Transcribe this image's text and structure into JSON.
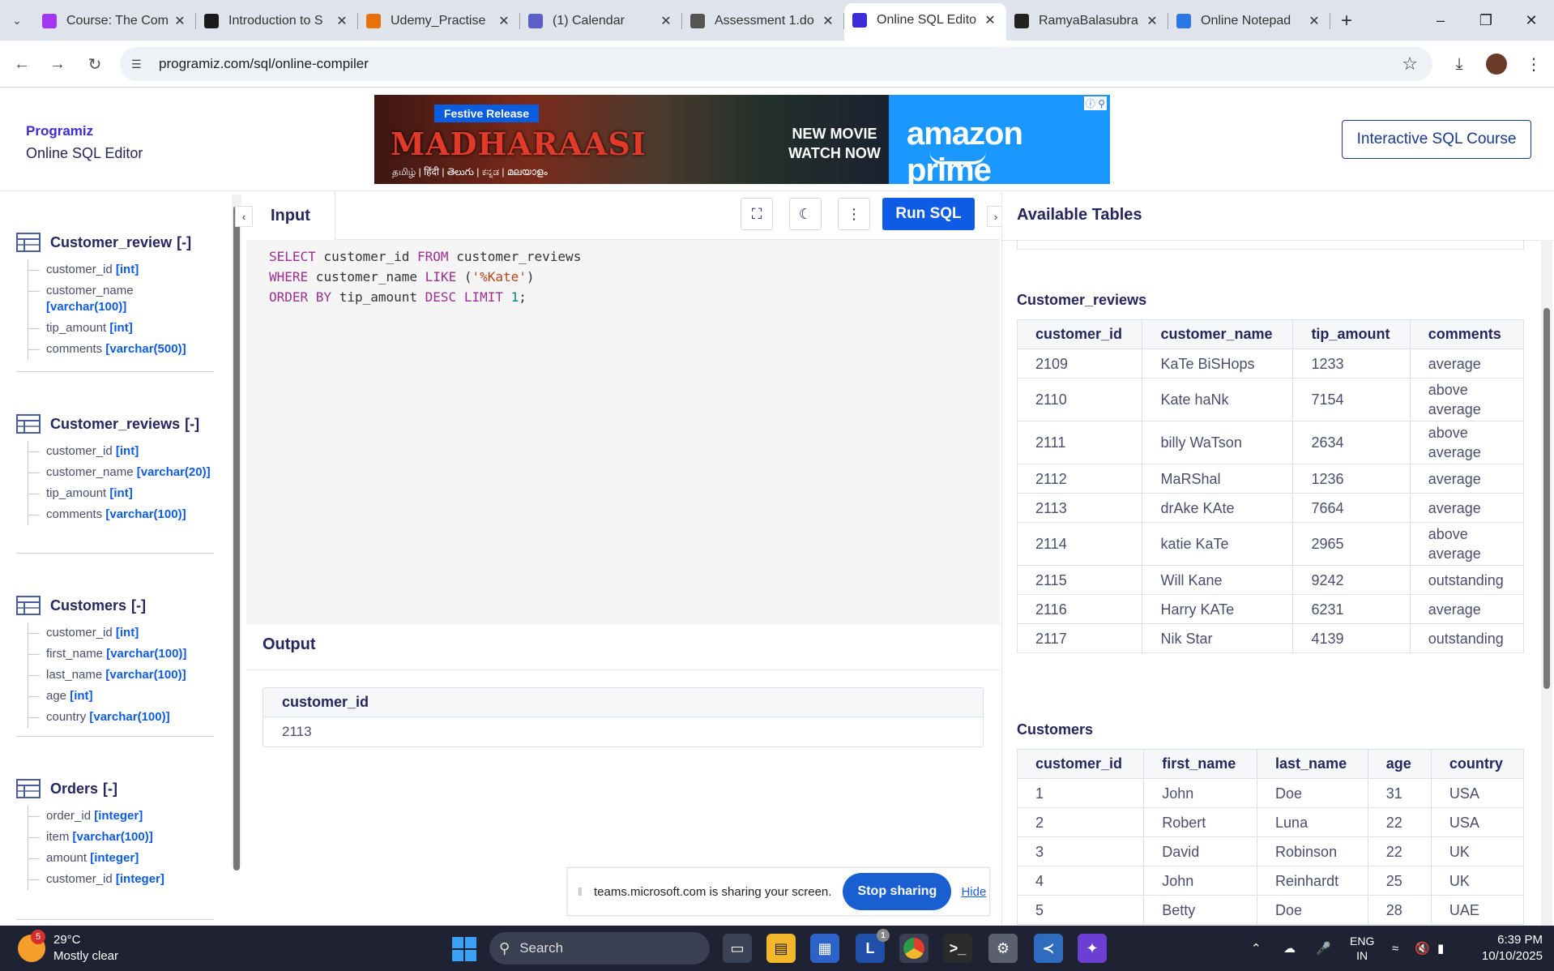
{
  "browser": {
    "tabs": [
      {
        "label": "Course: The Com",
        "icon": "course-icon",
        "color": "#a435f0"
      },
      {
        "label": "Introduction to S",
        "icon": "hackerrank-icon",
        "color": "#1b1b1b"
      },
      {
        "label": "Udemy_Practise",
        "icon": "doc-icon",
        "color": "#e8710a"
      },
      {
        "label": "(1) Calendar",
        "icon": "teams-icon",
        "color": "#5b5fc7"
      },
      {
        "label": "Assessment 1.do",
        "icon": "globe-icon",
        "color": "#555"
      },
      {
        "label": "Online SQL Edito",
        "icon": "programiz-icon",
        "color": "#3c2bd6",
        "active": true
      },
      {
        "label": "RamyaBalasubra",
        "icon": "github-icon",
        "color": "#222"
      },
      {
        "label": "Online Notepad",
        "icon": "notepad-icon",
        "color": "#2b78e4"
      }
    ],
    "url": "programiz.com/sql/online-compiler"
  },
  "site": {
    "logo": "Programiz",
    "subtitle": "Online SQL Editor",
    "course_button": "Interactive SQL Course",
    "ad": {
      "badge": "Festive Release",
      "movie": "MADHARAASI",
      "languages": "தமிழ் | हिंदी | తెలుగు | ಕನ್ನಡ | മലയാളം",
      "cta_line1": "NEW MOVIE",
      "cta_line2": "WATCH NOW",
      "brand": "amazon prime"
    }
  },
  "sidebar": {
    "tables": [
      {
        "name": "Customer_review",
        "toggle": "[-]",
        "columns": [
          {
            "name": "customer_id",
            "type": "[int]"
          },
          {
            "name": "customer_name",
            "type": "[varchar(100)]"
          },
          {
            "name": "tip_amount",
            "type": "[int]"
          },
          {
            "name": "comments",
            "type": "[varchar(500)]"
          }
        ]
      },
      {
        "name": "Customer_reviews",
        "toggle": "[-]",
        "columns": [
          {
            "name": "customer_id",
            "type": "[int]"
          },
          {
            "name": "customer_name",
            "type": "[varchar(20)]"
          },
          {
            "name": "tip_amount",
            "type": "[int]"
          },
          {
            "name": "comments",
            "type": "[varchar(100)]"
          }
        ]
      },
      {
        "name": "Customers",
        "toggle": "[-]",
        "columns": [
          {
            "name": "customer_id",
            "type": "[int]"
          },
          {
            "name": "first_name",
            "type": "[varchar(100)]"
          },
          {
            "name": "last_name",
            "type": "[varchar(100)]"
          },
          {
            "name": "age",
            "type": "[int]"
          },
          {
            "name": "country",
            "type": "[varchar(100)]"
          }
        ]
      },
      {
        "name": "Orders",
        "toggle": "[-]",
        "columns": [
          {
            "name": "order_id",
            "type": "[integer]"
          },
          {
            "name": "item",
            "type": "[varchar(100)]"
          },
          {
            "name": "amount",
            "type": "[integer]"
          },
          {
            "name": "customer_id",
            "type": "[integer]"
          }
        ]
      }
    ]
  },
  "editor": {
    "input_label": "Input",
    "run_label": "Run SQL",
    "code_lines": [
      [
        {
          "t": "SELECT",
          "c": "kw"
        },
        {
          "t": " customer_id ",
          "c": ""
        },
        {
          "t": "FROM",
          "c": "kw"
        },
        {
          "t": " customer_reviews",
          "c": ""
        }
      ],
      [
        {
          "t": "WHERE",
          "c": "kw"
        },
        {
          "t": " customer_name ",
          "c": ""
        },
        {
          "t": "LIKE",
          "c": "kw"
        },
        {
          "t": " (",
          "c": ""
        },
        {
          "t": "'%Kate'",
          "c": "str"
        },
        {
          "t": ")",
          "c": ""
        }
      ],
      [
        {
          "t": "ORDER BY",
          "c": "kw"
        },
        {
          "t": " tip_amount ",
          "c": ""
        },
        {
          "t": "DESC LIMIT",
          "c": "kw"
        },
        {
          "t": " ",
          "c": ""
        },
        {
          "t": "1",
          "c": "num"
        },
        {
          "t": ";",
          "c": ""
        }
      ]
    ],
    "output_label": "Output",
    "output": {
      "header": "customer_id",
      "value": "2113"
    }
  },
  "share_bar": {
    "text": "teams.microsoft.com is sharing your screen.",
    "stop": "Stop sharing",
    "hide": "Hide"
  },
  "right_panel": {
    "title": "Available Tables",
    "customer_reviews": {
      "title": "Customer_reviews",
      "headers": [
        "customer_id",
        "customer_name",
        "tip_amount",
        "comments"
      ],
      "rows": [
        [
          "2109",
          "KaTe BiSHops",
          "1233",
          "average"
        ],
        [
          "2110",
          "Kate haNk",
          "7154",
          "above average"
        ],
        [
          "2111",
          "billy WaTson",
          "2634",
          "above average"
        ],
        [
          "2112",
          "MaRShal",
          "1236",
          "average"
        ],
        [
          "2113",
          "drAke KAte",
          "7664",
          "average"
        ],
        [
          "2114",
          "katie KaTe",
          "2965",
          "above average"
        ],
        [
          "2115",
          "Will Kane",
          "9242",
          "outstanding"
        ],
        [
          "2116",
          "Harry KATe",
          "6231",
          "average"
        ],
        [
          "2117",
          "Nik Star",
          "4139",
          "outstanding"
        ]
      ]
    },
    "customers": {
      "title": "Customers",
      "headers": [
        "customer_id",
        "first_name",
        "last_name",
        "age",
        "country"
      ],
      "rows": [
        [
          "1",
          "John",
          "Doe",
          "31",
          "USA"
        ],
        [
          "2",
          "Robert",
          "Luna",
          "22",
          "USA"
        ],
        [
          "3",
          "David",
          "Robinson",
          "22",
          "UK"
        ],
        [
          "4",
          "John",
          "Reinhardt",
          "25",
          "UK"
        ],
        [
          "5",
          "Betty",
          "Doe",
          "28",
          "UAE"
        ]
      ]
    }
  },
  "taskbar": {
    "weather_badge": "5",
    "temperature": "29°C",
    "condition": "Mostly clear",
    "search": "Search",
    "lang_top": "ENG",
    "lang_bottom": "IN",
    "time": "6:39 PM",
    "date": "10/10/2025",
    "l_badge": "1"
  }
}
